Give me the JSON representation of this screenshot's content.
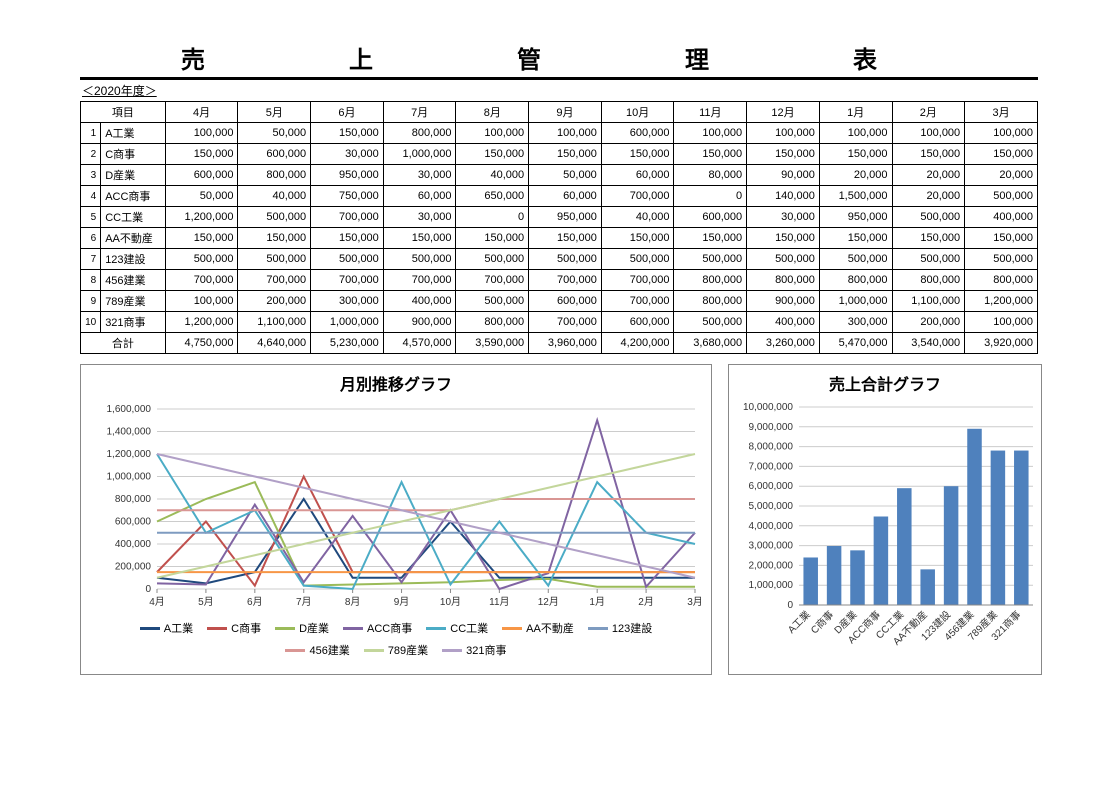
{
  "title": "売　上　管　理　表",
  "year_label": "＜2020年度＞",
  "months": [
    "4月",
    "5月",
    "6月",
    "7月",
    "8月",
    "9月",
    "10月",
    "11月",
    "12月",
    "1月",
    "2月",
    "3月"
  ],
  "header_item": "項目",
  "header_total": "合計",
  "rows": [
    {
      "idx": "1",
      "name": "A工業",
      "values": [
        100000,
        50000,
        150000,
        800000,
        100000,
        100000,
        600000,
        100000,
        100000,
        100000,
        100000,
        100000
      ]
    },
    {
      "idx": "2",
      "name": "C商事",
      "values": [
        150000,
        600000,
        30000,
        1000000,
        150000,
        150000,
        150000,
        150000,
        150000,
        150000,
        150000,
        150000
      ]
    },
    {
      "idx": "3",
      "name": "D産業",
      "values": [
        600000,
        800000,
        950000,
        30000,
        40000,
        50000,
        60000,
        80000,
        90000,
        20000,
        20000,
        20000
      ]
    },
    {
      "idx": "4",
      "name": "ACC商事",
      "values": [
        50000,
        40000,
        750000,
        60000,
        650000,
        60000,
        700000,
        0,
        140000,
        1500000,
        20000,
        500000
      ]
    },
    {
      "idx": "5",
      "name": "CC工業",
      "values": [
        1200000,
        500000,
        700000,
        30000,
        0,
        950000,
        40000,
        600000,
        30000,
        950000,
        500000,
        400000
      ]
    },
    {
      "idx": "6",
      "name": "AA不動産",
      "values": [
        150000,
        150000,
        150000,
        150000,
        150000,
        150000,
        150000,
        150000,
        150000,
        150000,
        150000,
        150000
      ]
    },
    {
      "idx": "7",
      "name": "123建設",
      "values": [
        500000,
        500000,
        500000,
        500000,
        500000,
        500000,
        500000,
        500000,
        500000,
        500000,
        500000,
        500000
      ]
    },
    {
      "idx": "8",
      "name": "456建業",
      "values": [
        700000,
        700000,
        700000,
        700000,
        700000,
        700000,
        700000,
        800000,
        800000,
        800000,
        800000,
        800000
      ]
    },
    {
      "idx": "9",
      "name": "789産業",
      "values": [
        100000,
        200000,
        300000,
        400000,
        500000,
        600000,
        700000,
        800000,
        900000,
        1000000,
        1100000,
        1200000
      ]
    },
    {
      "idx": "10",
      "name": "321商事",
      "values": [
        1200000,
        1100000,
        1000000,
        900000,
        800000,
        700000,
        600000,
        500000,
        400000,
        300000,
        200000,
        100000
      ]
    }
  ],
  "totals": [
    4750000,
    4640000,
    5230000,
    4570000,
    3590000,
    3960000,
    4200000,
    3680000,
    3260000,
    5470000,
    3540000,
    3920000
  ],
  "chart_data": {
    "line": {
      "type": "line",
      "title": "月別推移グラフ",
      "categories": [
        "4月",
        "5月",
        "6月",
        "7月",
        "8月",
        "9月",
        "10月",
        "11月",
        "12月",
        "1月",
        "2月",
        "3月"
      ],
      "ymin": 0,
      "ymax": 1600000,
      "ystep": 200000,
      "series": [
        {
          "name": "A工業",
          "color": "#1f497d",
          "values": [
            100000,
            50000,
            150000,
            800000,
            100000,
            100000,
            600000,
            100000,
            100000,
            100000,
            100000,
            100000
          ]
        },
        {
          "name": "C商事",
          "color": "#c0504d",
          "values": [
            150000,
            600000,
            30000,
            1000000,
            150000,
            150000,
            150000,
            150000,
            150000,
            150000,
            150000,
            150000
          ]
        },
        {
          "name": "D産業",
          "color": "#9bbb59",
          "values": [
            600000,
            800000,
            950000,
            30000,
            40000,
            50000,
            60000,
            80000,
            90000,
            20000,
            20000,
            20000
          ]
        },
        {
          "name": "ACC商事",
          "color": "#8064a2",
          "values": [
            50000,
            40000,
            750000,
            60000,
            650000,
            60000,
            700000,
            0,
            140000,
            1500000,
            20000,
            500000
          ]
        },
        {
          "name": "CC工業",
          "color": "#4bacc6",
          "values": [
            1200000,
            500000,
            700000,
            30000,
            0,
            950000,
            40000,
            600000,
            30000,
            950000,
            500000,
            400000
          ]
        },
        {
          "name": "AA不動産",
          "color": "#f79646",
          "values": [
            150000,
            150000,
            150000,
            150000,
            150000,
            150000,
            150000,
            150000,
            150000,
            150000,
            150000,
            150000
          ]
        },
        {
          "name": "123建設",
          "color": "#7e9bc0",
          "values": [
            500000,
            500000,
            500000,
            500000,
            500000,
            500000,
            500000,
            500000,
            500000,
            500000,
            500000,
            500000
          ]
        },
        {
          "name": "456建業",
          "color": "#d99694",
          "values": [
            700000,
            700000,
            700000,
            700000,
            700000,
            700000,
            700000,
            800000,
            800000,
            800000,
            800000,
            800000
          ]
        },
        {
          "name": "789産業",
          "color": "#c3d69b",
          "values": [
            100000,
            200000,
            300000,
            400000,
            500000,
            600000,
            700000,
            800000,
            900000,
            1000000,
            1100000,
            1200000
          ]
        },
        {
          "name": "321商事",
          "color": "#b1a0c7",
          "values": [
            1200000,
            1100000,
            1000000,
            900000,
            800000,
            700000,
            600000,
            500000,
            400000,
            300000,
            200000,
            100000
          ]
        }
      ]
    },
    "bar": {
      "type": "bar",
      "title": "売上合計グラフ",
      "categories": [
        "A工業",
        "C商事",
        "D産業",
        "ACC商事",
        "CC工業",
        "AA不動産",
        "123建設",
        "456建業",
        "789産業",
        "321商事"
      ],
      "ymin": 0,
      "ymax": 10000000,
      "ystep": 1000000,
      "color": "#4f81bd",
      "values": [
        2400000,
        2980000,
        2760000,
        4470000,
        5900000,
        1800000,
        6000000,
        8900000,
        7800000,
        7800000
      ],
      "note_last_cut": true
    }
  }
}
